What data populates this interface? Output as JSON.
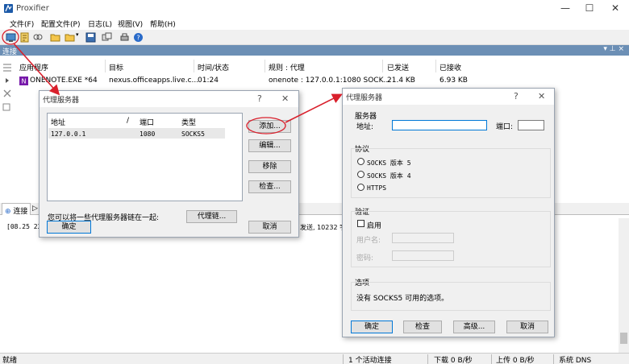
{
  "window": {
    "title": "Proxifier",
    "minimize": "—",
    "maximize": "☐",
    "close": "✕"
  },
  "menu": [
    "文件(F)",
    "配置文件(P)",
    "日志(L)",
    "视图(V)",
    "帮助(H)"
  ],
  "section": {
    "title": "连接",
    "buttons": "▾ ⊥ ×"
  },
  "columns": [
    "应用程序",
    "目标",
    "时间/状态",
    "规则 : 代理",
    "已发送",
    "已接收"
  ],
  "row": {
    "app": "ONENOTE.EXE *64",
    "target": "nexus.officeapps.live.c...",
    "time": "01:24",
    "rule": "onenote : 127.0.0.1:1080 SOCK...",
    "sent": "21.4 KB",
    "received": "6.93 KB"
  },
  "tabs": {
    "active": "连接",
    "more": "▷"
  },
  "log": {
    "line1": "[08.25 23",
    "line1_right": "发送, 10232 字"
  },
  "status": {
    "ready": "就绪",
    "active": "1 个活动连接",
    "download": "下载 0 B/秒",
    "upload": "上传 0 B/秒",
    "dns": "系统 DNS"
  },
  "dialog_left": {
    "title": "代理服务器",
    "help": "?",
    "close": "✕",
    "headers": {
      "address": "地址",
      "slash": "/",
      "port": "端口",
      "type": "类型"
    },
    "row": {
      "address": "127.0.0.1",
      "port": "1080",
      "type": "SOCKS5"
    },
    "add": "添加...",
    "edit": "编辑...",
    "remove": "移除",
    "check": "检查...",
    "chain_text": "您可以将一些代理服务器链在一起:",
    "chain": "代理链...",
    "ok": "确定",
    "cancel": "取消"
  },
  "dialog_right": {
    "title": "代理服务器",
    "help": "?",
    "close": "✕",
    "server_group": "服务器",
    "address_label": "地址:",
    "address_value": "",
    "port_label": "端口:",
    "port_value": "",
    "protocol_group": "协议",
    "protocols": [
      "SOCKS 版本 5",
      "SOCKS 版本 4",
      "HTTPS"
    ],
    "auth_group": "验证",
    "enable": "启用",
    "username": "用户名:",
    "password": "密码:",
    "options_group": "选项",
    "options_text": "没有 SOCKS5 可用的选项。",
    "ok": "确定",
    "check": "检查",
    "advanced": "高级...",
    "cancel": "取消"
  },
  "colors": {
    "annotation": "#d9202c",
    "section_bar": "#6c8fb5",
    "onenote": "#7719aa",
    "focus": "#0078d7"
  }
}
